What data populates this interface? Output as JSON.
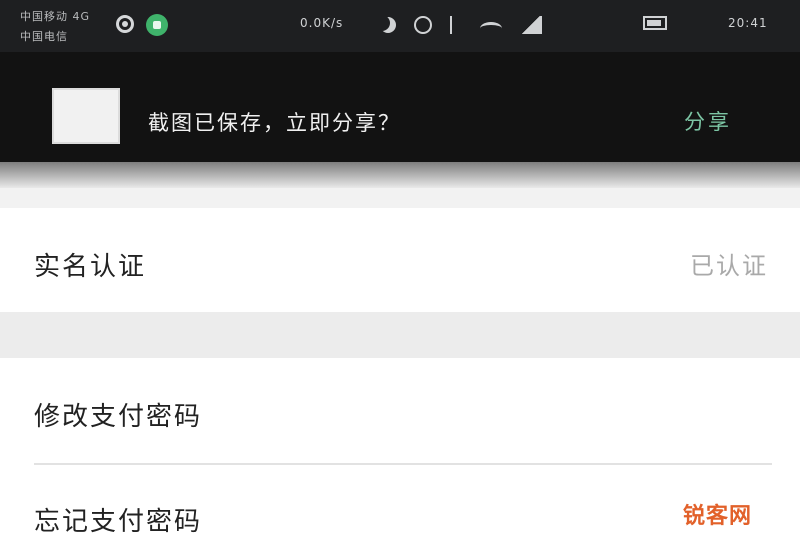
{
  "status_bar": {
    "carrier_1": "中国移动 4G",
    "carrier_2": "中国电信",
    "net_speed": "0.0K/s",
    "time": "20:41"
  },
  "notice": {
    "text": "截图已保存，立即分享？",
    "share_label": "分享"
  },
  "settings": {
    "items": [
      {
        "label": "实名认证",
        "value": "已认证"
      },
      {
        "label": "修改支付密码"
      },
      {
        "label": "忘记支付密码"
      }
    ]
  },
  "watermark": "锐客网",
  "colors": {
    "status_bg": "#1e1f21",
    "notice_bg": "#121212",
    "share_accent": "#7cc5a4",
    "badge_green": "#3fb36b",
    "watermark": "#e2612a"
  }
}
